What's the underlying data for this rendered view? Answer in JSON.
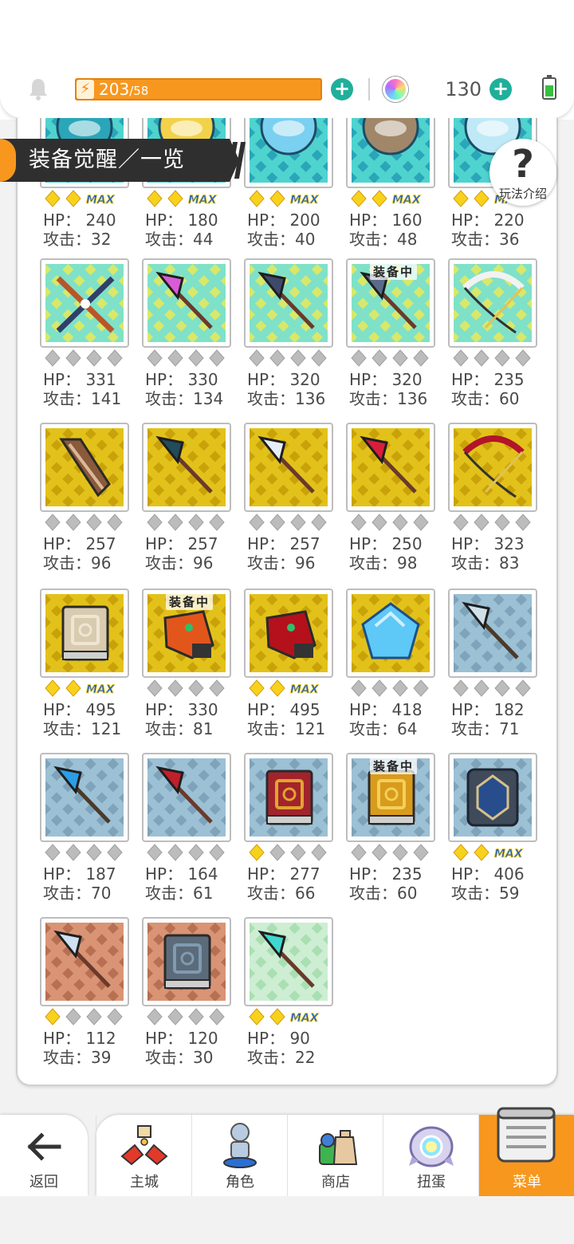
{
  "header": {
    "stamina_current": "203",
    "stamina_separator": "/",
    "stamina_max": "58",
    "gem_count": "130"
  },
  "page": {
    "title": "装备觉醒／一览",
    "help_label": "玩法介绍"
  },
  "items": [
    {
      "bg": "teal",
      "weapon": "orb-teal",
      "stars": 2,
      "max": true,
      "hp": "HP： 240",
      "atk": "攻击：32",
      "equipped": false
    },
    {
      "bg": "teal",
      "weapon": "orb-gold",
      "stars": 2,
      "max": true,
      "hp": "HP： 180",
      "atk": "攻击：44",
      "equipped": false
    },
    {
      "bg": "teal",
      "weapon": "orb-sky",
      "stars": 2,
      "max": true,
      "hp": "HP： 200",
      "atk": "攻击：40",
      "equipped": false
    },
    {
      "bg": "teal",
      "weapon": "orb-earth",
      "stars": 2,
      "max": true,
      "hp": "HP： 160",
      "atk": "攻击：48",
      "equipped": false
    },
    {
      "bg": "teal",
      "weapon": "orb-ice",
      "stars": 2,
      "max": true,
      "hp": "HP： 220",
      "atk": "攻击：36",
      "equipped": false
    },
    {
      "bg": "rainbow",
      "weapon": "crossed-blades",
      "stars": 0,
      "max": false,
      "hp": "HP： 331",
      "atk": "攻击：141",
      "equipped": false
    },
    {
      "bg": "rainbow",
      "weapon": "staff-gem",
      "stars": 0,
      "max": false,
      "hp": "HP： 330",
      "atk": "攻击：134",
      "equipped": false
    },
    {
      "bg": "rainbow",
      "weapon": "scythe",
      "stars": 0,
      "max": false,
      "hp": "HP： 320",
      "atk": "攻击：136",
      "equipped": false
    },
    {
      "bg": "rainbow",
      "weapon": "axe-dark",
      "stars": 0,
      "max": false,
      "hp": "HP： 320",
      "atk": "攻击：136",
      "equipped": true
    },
    {
      "bg": "rainbow",
      "weapon": "bow-white",
      "stars": 0,
      "max": false,
      "hp": "HP： 235",
      "atk": "攻击：60",
      "equipped": false
    },
    {
      "bg": "gold",
      "weapon": "chainsaw",
      "stars": 0,
      "max": false,
      "hp": "HP： 257",
      "atk": "攻击：96",
      "equipped": false
    },
    {
      "bg": "gold",
      "weapon": "halberd",
      "stars": 0,
      "max": false,
      "hp": "HP： 257",
      "atk": "攻击：96",
      "equipped": false
    },
    {
      "bg": "gold",
      "weapon": "spear-blue",
      "stars": 0,
      "max": false,
      "hp": "HP： 257",
      "atk": "攻击：96",
      "equipped": false
    },
    {
      "bg": "gold",
      "weapon": "staff-red",
      "stars": 0,
      "max": false,
      "hp": "HP： 250",
      "atk": "攻击：98",
      "equipped": false
    },
    {
      "bg": "gold",
      "weapon": "bow-red",
      "stars": 0,
      "max": false,
      "hp": "HP： 323",
      "atk": "攻击：83",
      "equipped": false
    },
    {
      "bg": "gold",
      "weapon": "book-parchment",
      "stars": 2,
      "max": true,
      "hp": "HP： 495",
      "atk": "攻击：121",
      "equipped": false
    },
    {
      "bg": "gold",
      "weapon": "gauntlet-orange",
      "stars": 0,
      "max": false,
      "hp": "HP： 330",
      "atk": "攻击：81",
      "equipped": true
    },
    {
      "bg": "gold",
      "weapon": "gauntlet-red",
      "stars": 2,
      "max": true,
      "hp": "HP： 495",
      "atk": "攻击：121",
      "equipped": false
    },
    {
      "bg": "gold",
      "weapon": "gem-blue",
      "stars": 0,
      "max": false,
      "hp": "HP： 418",
      "atk": "攻击：64",
      "equipped": false
    },
    {
      "bg": "steel",
      "weapon": "sword",
      "stars": 0,
      "max": false,
      "hp": "HP： 182",
      "atk": "攻击：71",
      "equipped": false
    },
    {
      "bg": "steel",
      "weapon": "sword-blue",
      "stars": 0,
      "max": false,
      "hp": "HP： 187",
      "atk": "攻击：70",
      "equipped": false
    },
    {
      "bg": "steel",
      "weapon": "spear-red",
      "stars": 0,
      "max": false,
      "hp": "HP： 164",
      "atk": "攻击：61",
      "equipped": false
    },
    {
      "bg": "steel",
      "weapon": "book-red",
      "stars": 1,
      "max": false,
      "hp": "HP： 277",
      "atk": "攻击：66",
      "equipped": false
    },
    {
      "bg": "steel",
      "weapon": "book-gold",
      "stars": 0,
      "max": false,
      "hp": "HP： 235",
      "atk": "攻击：60",
      "equipped": true
    },
    {
      "bg": "steel",
      "weapon": "shield-blue",
      "stars": 2,
      "max": true,
      "hp": "HP： 406",
      "atk": "攻击：59",
      "equipped": false
    },
    {
      "bg": "bronze",
      "weapon": "spear-bronze",
      "stars": 1,
      "max": false,
      "hp": "HP： 112",
      "atk": "攻击：39",
      "equipped": false
    },
    {
      "bg": "bronze",
      "weapon": "book-grey",
      "stars": 0,
      "max": false,
      "hp": "HP： 120",
      "atk": "攻击：30",
      "equipped": false
    },
    {
      "bg": "green",
      "weapon": "wand",
      "stars": 2,
      "max": true,
      "hp": "HP： 90",
      "atk": "攻击：22",
      "equipped": false
    }
  ],
  "equipped_label": "装备中",
  "max_label": "MAX",
  "nav": {
    "back_label": "返回",
    "tabs": [
      {
        "label": "主城",
        "icon": "castle-icon"
      },
      {
        "label": "角色",
        "icon": "character-icon"
      },
      {
        "label": "商店",
        "icon": "shop-icon"
      },
      {
        "label": "扭蛋",
        "icon": "gacha-icon"
      },
      {
        "label": "菜单",
        "icon": "menu-icon",
        "active": true
      }
    ]
  },
  "colors": {
    "accent_orange": "#f7971e",
    "plus_teal": "#1fb09a",
    "bg_gold": "#d8b80c",
    "bg_teal": "#3fc7c9",
    "bg_steel": "#8fb3c8",
    "bg_bronze": "#c98364",
    "bg_green": "#bfe8c6"
  }
}
